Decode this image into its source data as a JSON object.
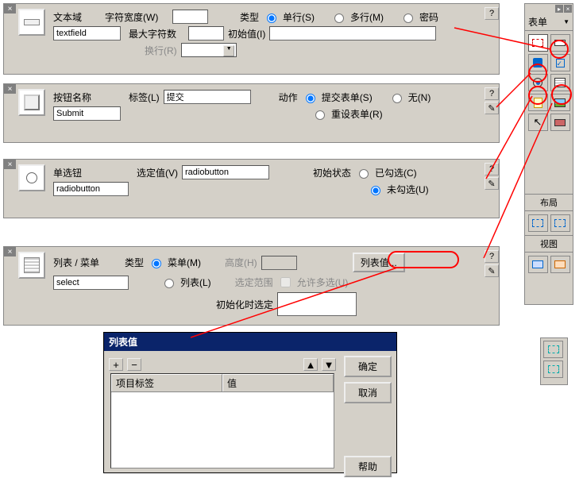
{
  "textfield_panel": {
    "title": "文本域",
    "name_value": "textfield",
    "char_width_label": "字符宽度(W)",
    "max_chars_label": "最大字符数",
    "type_label": "类型",
    "opt_single": "单行(S)",
    "opt_multi": "多行(M)",
    "opt_password": "密码",
    "init_val_label": "初始值(I)",
    "wrap_label": "换行(R)"
  },
  "button_panel": {
    "title": "按钮名称",
    "name_value": "Submit",
    "label_label": "标签(L)",
    "label_value": "提交",
    "action_label": "动作",
    "opt_submit": "提交表单(S)",
    "opt_none": "无(N)",
    "opt_reset": "重设表单(R)"
  },
  "radio_panel": {
    "title": "单选钮",
    "name_value": "radiobutton",
    "selval_label": "选定值(V)",
    "selval_value": "radiobutton",
    "initstate_label": "初始状态",
    "opt_checked": "已勾选(C)",
    "opt_unchecked": "未勾选(U)"
  },
  "list_panel": {
    "title": "列表 / 菜单",
    "name_value": "select",
    "type_label": "类型",
    "opt_menu": "菜单(M)",
    "opt_list": "列表(L)",
    "height_label": "高度(H)",
    "selrange_label": "选定范围",
    "allow_multi": "允许多选(U)",
    "listval_btn": "列表值...",
    "init_sel_label": "初始化时选定"
  },
  "dialog": {
    "title": "列表值",
    "col1": "项目标签",
    "col2": "值",
    "ok": "确定",
    "cancel": "取消",
    "help": "帮助"
  },
  "toolbox": {
    "header": "表单",
    "layout_label": "布局",
    "view_label": "视图"
  }
}
